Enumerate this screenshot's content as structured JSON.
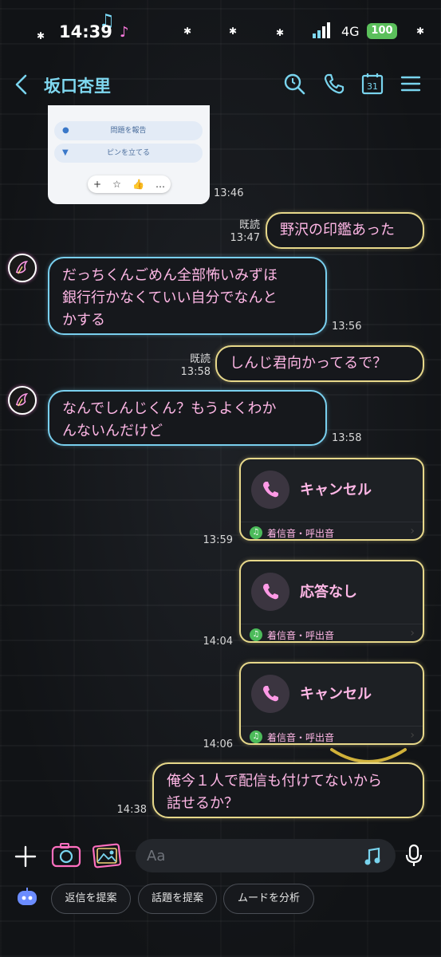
{
  "status_bar": {
    "time": "14:39",
    "network": "4G",
    "battery": "100"
  },
  "header": {
    "contact_name": "坂口杏里"
  },
  "image_card": {
    "row1": "問題を報告",
    "row2": "ピンを立てる",
    "reactions": [
      "+",
      "☆",
      "👍",
      "…"
    ],
    "time": "13:46"
  },
  "messages": [
    {
      "id": "m1",
      "dir": "out",
      "text": "野沢の印鑑あった",
      "read": "既読",
      "time": "13:47"
    },
    {
      "id": "m2",
      "dir": "in",
      "lines": [
        "だっちくんごめん全部怖いみずほ",
        "銀行行かなくていい自分でなんと",
        "かする"
      ],
      "time": "13:56"
    },
    {
      "id": "m3",
      "dir": "out",
      "text": "しんじ君向かってるで？",
      "read": "既読",
      "time": "13:58"
    },
    {
      "id": "m4",
      "dir": "in",
      "lines": [
        "なんでしんじくん？もうよくわか",
        "んないんだけど"
      ],
      "time": "13:58"
    },
    {
      "id": "m8",
      "dir": "out",
      "lines": [
        "俺今１人で配信も付けてないから",
        "話せるか？"
      ],
      "time": "14:38"
    }
  ],
  "calls": [
    {
      "title": "キャンセル",
      "label": "着信音・呼出音",
      "time": "13:59"
    },
    {
      "title": "応答なし",
      "label": "着信音・呼出音",
      "time": "14:04"
    },
    {
      "title": "キャンセル",
      "label": "着信音・呼出音",
      "time": "14:06"
    }
  ],
  "input": {
    "placeholder": "Aa"
  },
  "suggestions": [
    "返信を提案",
    "話題を提案",
    "ムードを分析"
  ],
  "colors": {
    "accent_cyan": "#79d4ee",
    "bubble_out_border": "#e7d88a",
    "bubble_in_border": "#79cfee",
    "text_pink": "#ffb7e6"
  }
}
